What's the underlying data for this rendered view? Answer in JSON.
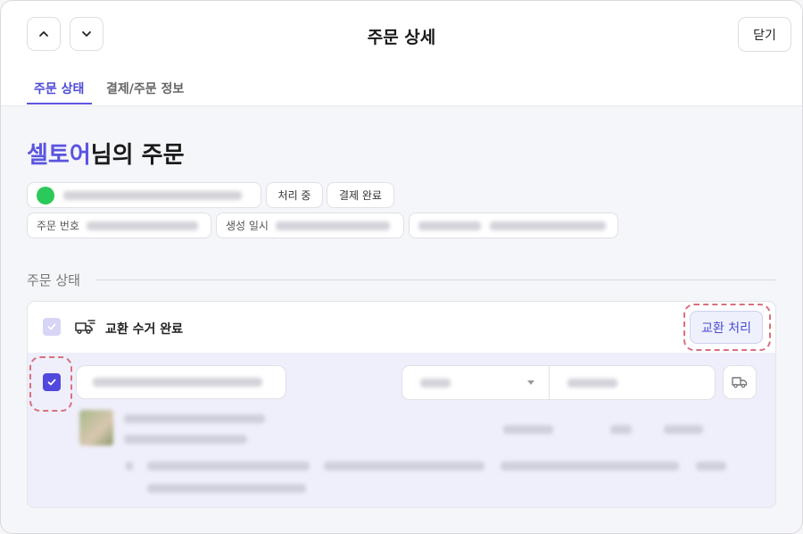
{
  "header": {
    "prev_icon": "chevron-up-icon",
    "next_icon": "chevron-down-icon",
    "title": "주문 상세",
    "close_label": "닫기"
  },
  "tabs": [
    {
      "label": "주문 상태",
      "active": true
    },
    {
      "label": "결제/주문 정보",
      "active": false
    }
  ],
  "heading": {
    "name": "셀토어",
    "suffix": "님의 주문"
  },
  "chips": {
    "processing": "처리 중",
    "payment_done": "결제 완료",
    "order_no_label": "주문 번호",
    "created_label": "생성 일시"
  },
  "section": {
    "label": "주문 상태"
  },
  "status_row": {
    "label": "교환 수거 완료",
    "action_label": "교환 처리"
  },
  "colors": {
    "accent": "#5b54e0",
    "highlight_dash": "#d9707e",
    "panel_body_bg": "#efeffb"
  }
}
